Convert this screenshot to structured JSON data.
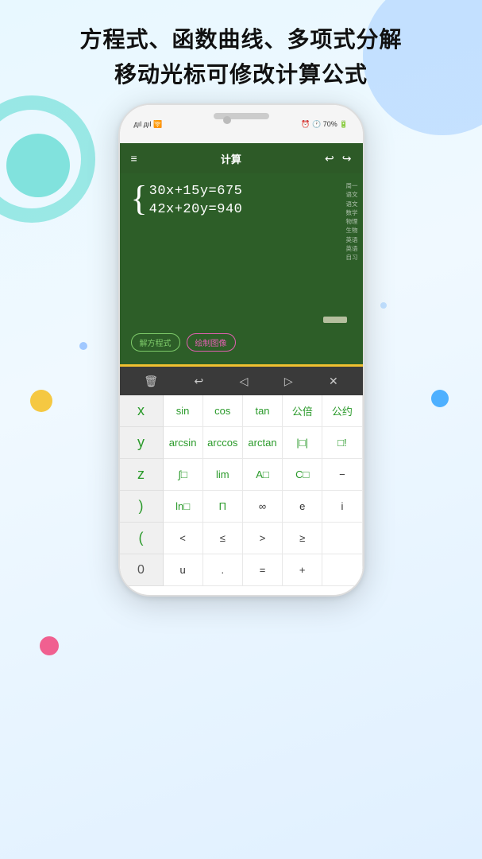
{
  "app": {
    "title_line1": "方程式、函数曲线、多项式分解",
    "title_line2": "移动光标可修改计算公式",
    "title_highlight": "方程式、函数曲线、多项式分解"
  },
  "phone": {
    "status": {
      "signal": "дıl дıl",
      "wifi": "🛜",
      "time_icon": "🕐",
      "battery": "70%",
      "battery_icon": "🔋",
      "alarm": "⏰"
    },
    "header": {
      "title": "计算",
      "menu_icon": "≡",
      "undo_icon": "↩",
      "redo_icon": "↪"
    },
    "chalkboard": {
      "equation1": "30x+15y=675",
      "equation2": "42x+20y=940",
      "sidebar_labels": [
        "周一",
        "语文",
        "语文",
        "数学",
        "物理",
        "生物",
        "英语",
        "英语",
        "自习"
      ]
    },
    "buttons": {
      "solve": "解方程式",
      "draw": "绘制图像"
    },
    "toolbar_icons": [
      "🗑",
      "↩",
      "◁",
      "▷",
      "✕"
    ],
    "keyboard": {
      "left_keys": [
        "x",
        "y",
        "z",
        ")",
        "(",
        "0"
      ],
      "right_keys": [
        [
          "sin",
          "cos",
          "tan",
          "公倍",
          "公约"
        ],
        [
          "arcsin",
          "arccos",
          "arctan",
          "| |",
          "[ ]"
        ],
        [
          "∫",
          "lim",
          "A",
          "C",
          "−"
        ],
        [
          "ln",
          "Π",
          "∞",
          "e",
          "i"
        ],
        [
          "<",
          "≤",
          ">",
          "≥",
          ""
        ],
        [
          "u",
          ".",
          "=",
          "+",
          ""
        ]
      ]
    }
  }
}
